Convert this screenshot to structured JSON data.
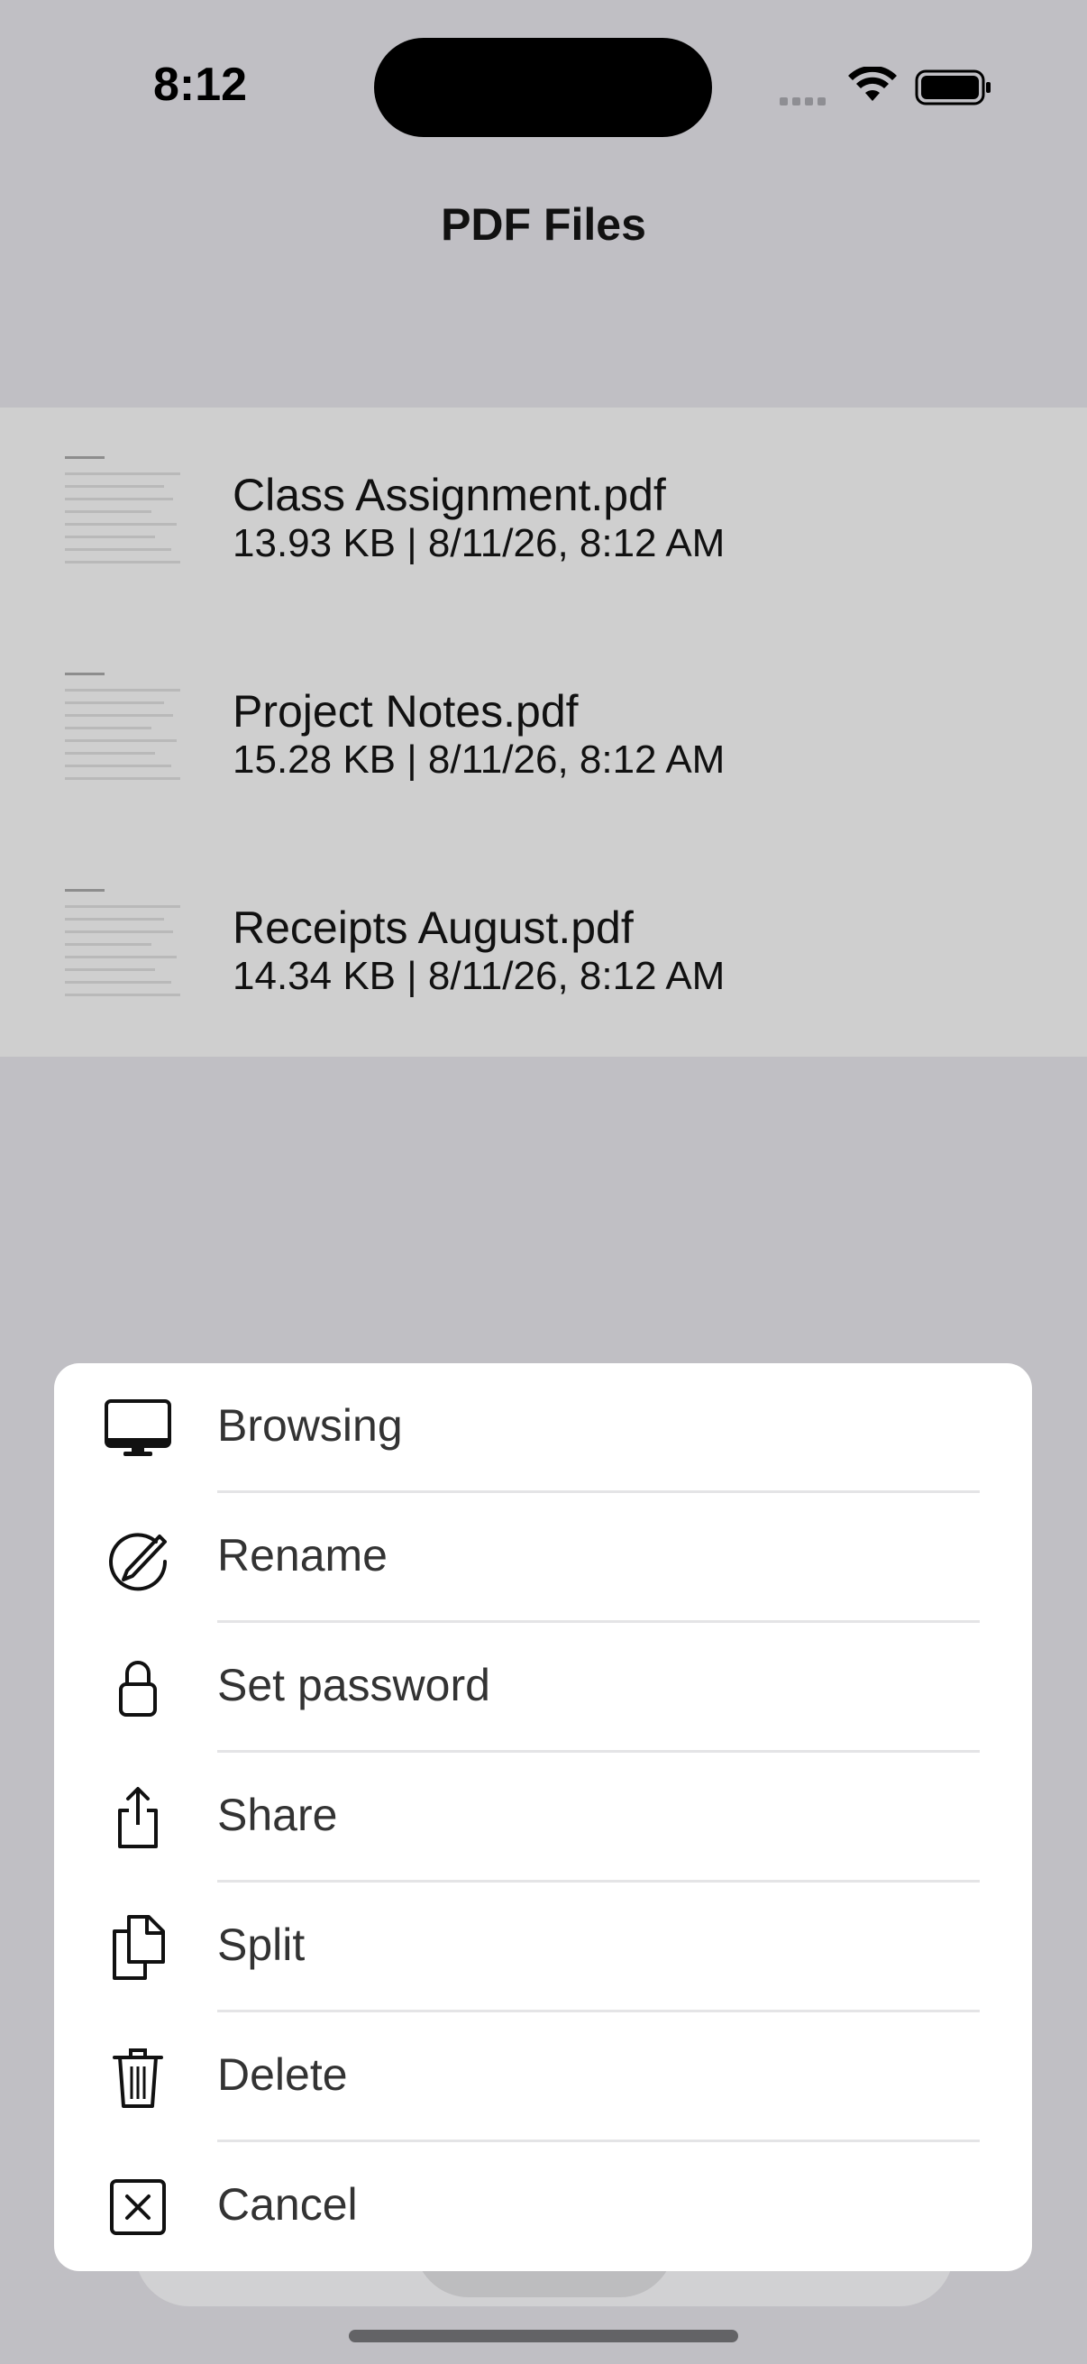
{
  "status_bar": {
    "time": "8:12"
  },
  "nav": {
    "title": "PDF Files"
  },
  "files": [
    {
      "name": "Class Assignment.pdf",
      "meta": "13.93 KB | 8/11/26, 8:12 AM"
    },
    {
      "name": "Project Notes.pdf",
      "meta": "15.28 KB | 8/11/26, 8:12 AM"
    },
    {
      "name": "Receipts August.pdf",
      "meta": "14.34 KB | 8/11/26, 8:12 AM"
    }
  ],
  "action_sheet": {
    "items": [
      {
        "label": "Browsing",
        "icon": "desktop-icon"
      },
      {
        "label": "Rename",
        "icon": "pencil-circle-icon"
      },
      {
        "label": "Set password",
        "icon": "lock-icon"
      },
      {
        "label": "Share",
        "icon": "share-icon"
      },
      {
        "label": "Split",
        "icon": "documents-icon"
      },
      {
        "label": "Delete",
        "icon": "trash-icon"
      },
      {
        "label": "Cancel",
        "icon": "close-box-icon"
      }
    ]
  },
  "colors": {
    "dim_background": "#c0bfc4",
    "list_background": "#cfcfcf",
    "sheet_background": "#ffffff",
    "label": "#333333"
  }
}
